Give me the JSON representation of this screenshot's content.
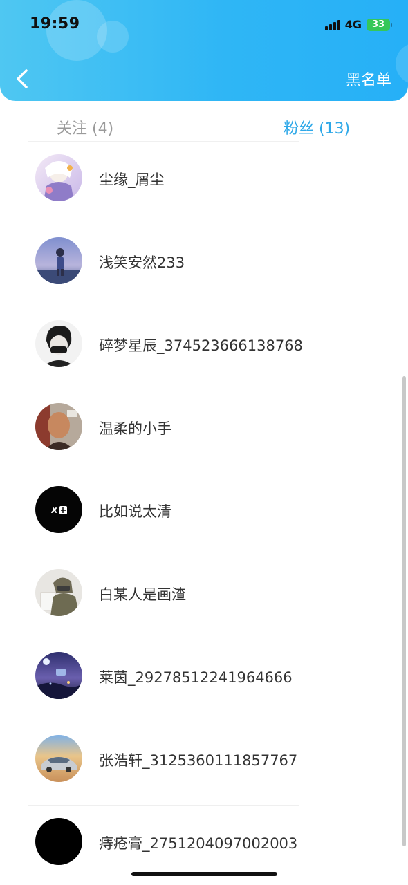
{
  "status_bar": {
    "time": "19:59",
    "network": "4G",
    "battery": "33"
  },
  "header": {
    "back_icon": "chevron-left-icon",
    "blacklist_label": "黑名单"
  },
  "tabs": {
    "following_label": "关注 (4)",
    "followers_label": "粉丝 (13)",
    "active": "followers"
  },
  "colors": {
    "header_gradient_start": "#4fc7f2",
    "header_gradient_end": "#26b0f7",
    "active_tab": "#2ea8e8",
    "inactive_tab": "#9a9a9a"
  },
  "followers": [
    {
      "name": "尘缘_屑尘"
    },
    {
      "name": "浅笑安然233"
    },
    {
      "name": "碎梦星辰_374523666138768"
    },
    {
      "name": "温柔的小手"
    },
    {
      "name": "比如说太清"
    },
    {
      "name": "白某人是画渣"
    },
    {
      "name": "莱茵_29278512241964666"
    },
    {
      "name": "张浩轩_3125360111857767"
    },
    {
      "name": "痔疮膏_2751204097002003"
    }
  ]
}
